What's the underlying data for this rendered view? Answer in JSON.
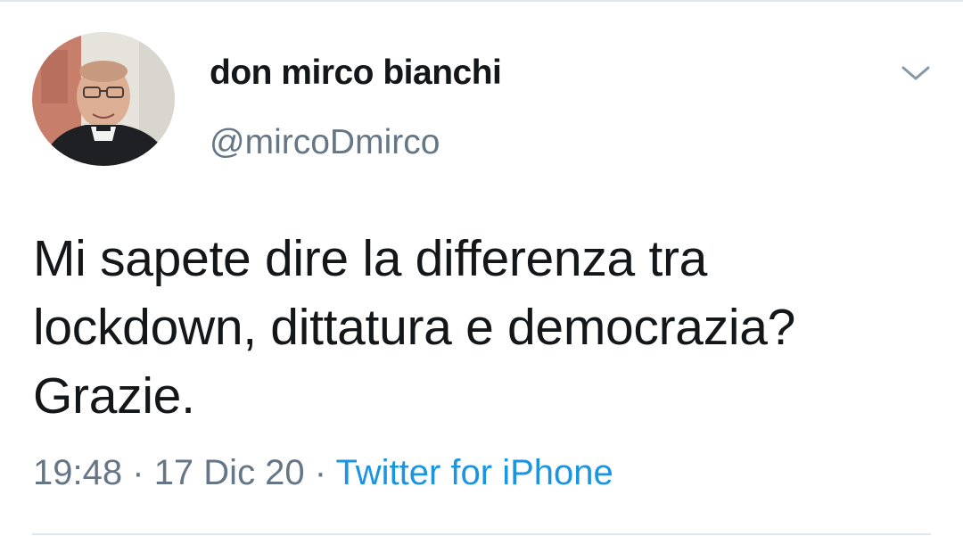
{
  "tweet": {
    "author": {
      "display_name": "don mirco bianchi",
      "handle": "@mircoDmirco",
      "avatar_icon": "profile-photo"
    },
    "menu_icon": "chevron-down-icon",
    "text_lines": [
      "Mi sapete dire la differenza tra",
      "lockdown, dittatura e democrazia?",
      "Grazie."
    ],
    "time": "19:48",
    "separator": "·",
    "date": "17 Dic 20",
    "source": "Twitter for iPhone",
    "colors": {
      "text": "#14171a",
      "secondary": "#657786",
      "link": "#1b95e0",
      "divider": "#e1e8ed"
    }
  }
}
